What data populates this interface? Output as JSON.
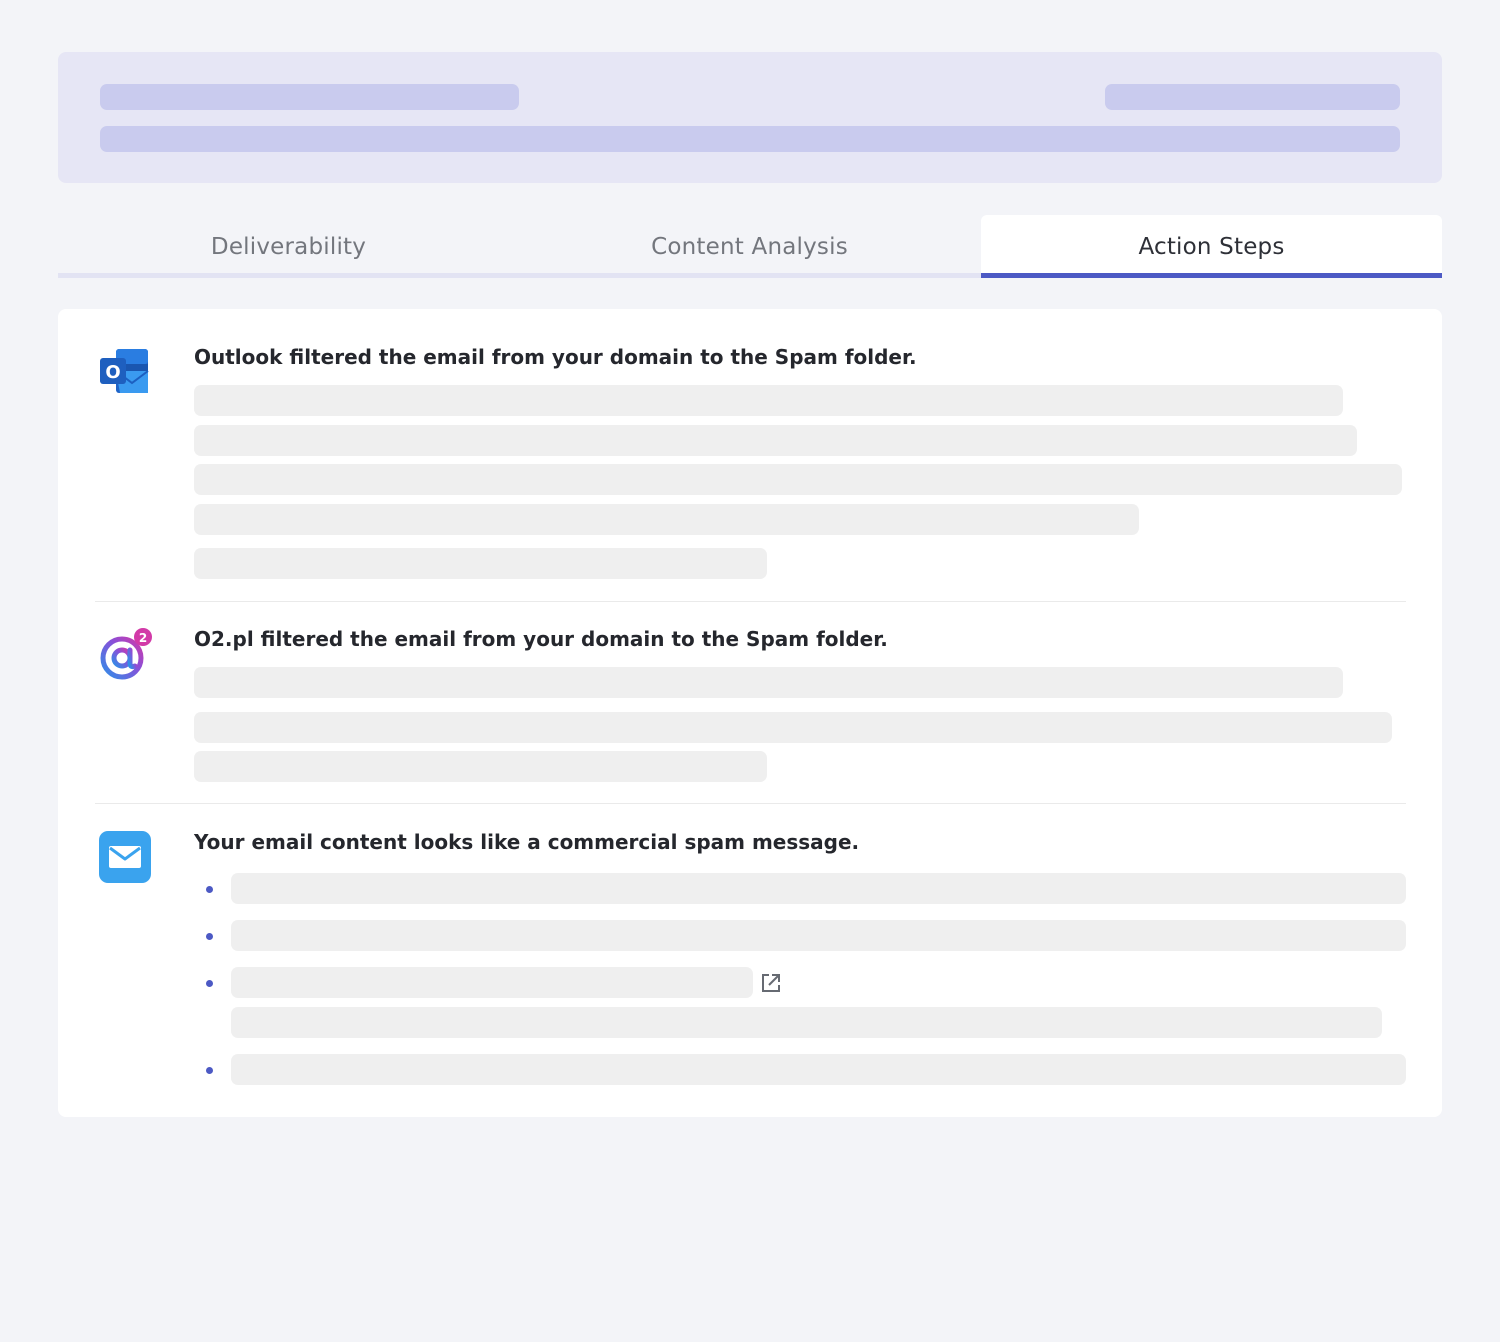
{
  "tabs": [
    {
      "label": "Deliverability",
      "active": false
    },
    {
      "label": "Content Analysis",
      "active": false
    },
    {
      "label": "Action Steps",
      "active": true
    }
  ],
  "sections": [
    {
      "icon": "outlook-icon",
      "title": "Outlook filtered the email from your domain to the Spam folder."
    },
    {
      "icon": "o2-icon",
      "title": "O2.pl filtered the email from your domain to the Spam folder."
    },
    {
      "icon": "mail-icon",
      "title": "Your email content looks like a commercial spam message."
    }
  ],
  "colors": {
    "accent": "#4c59c4",
    "page_background": "#f3f4f8",
    "header_skeleton": "#c9cbee",
    "content_skeleton": "#efefef",
    "mail_icon": "#3aa3ee"
  }
}
